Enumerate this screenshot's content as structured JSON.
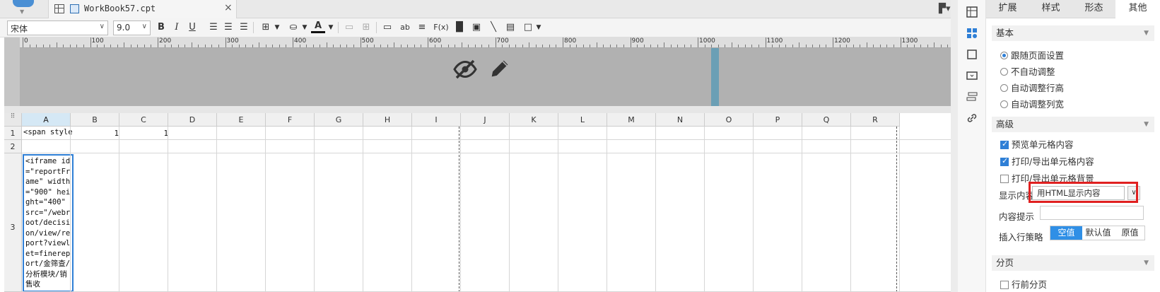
{
  "tab": {
    "title": "WorkBook57.cpt",
    "close": "×"
  },
  "toolbar": {
    "font": "宋体",
    "size": "9.0",
    "bold": "B",
    "italic": "I",
    "underline": "U",
    "text_color_glyph": "A",
    "text_tool": "ab",
    "formula": "F(x)"
  },
  "ruler": {
    "ticks": [
      "0",
      "100",
      "200",
      "300",
      "400",
      "500",
      "600",
      "700",
      "800",
      "900",
      "1000",
      "1100",
      "1200",
      "1300"
    ]
  },
  "sheet": {
    "columns": [
      "A",
      "B",
      "C",
      "D",
      "E",
      "F",
      "G",
      "H",
      "I",
      "J",
      "K",
      "L",
      "M",
      "N",
      "O",
      "P",
      "Q",
      "R"
    ],
    "rows": [
      "1",
      "2",
      "3"
    ],
    "cells": {
      "a1": "<span style",
      "b1": "1",
      "c1": "1",
      "a3": "<iframe id=\"reportFrame\" width=\"900\" height=\"400\" src=\"/webroot/decision/view/report?viewlet=finereport/金筛查/分析模块/销售收"
    }
  },
  "panel": {
    "tabs": [
      "扩展",
      "样式",
      "形态",
      "其他"
    ],
    "active_tab": "其他",
    "basic_section": "基本",
    "radios": [
      "跟随页面设置",
      "不自动调整",
      "自动调整行高",
      "自动调整列宽"
    ],
    "advanced_section": "高级",
    "checkboxes": [
      "预览单元格内容",
      "打印/导出单元格内容",
      "打印/导出单元格背景"
    ],
    "display_label": "显示内容",
    "display_value": "用HTML显示内容",
    "hint_label": "内容提示",
    "insert_label": "插入行策略",
    "insert_options": [
      "空值",
      "默认值",
      "原值"
    ],
    "paging_section": "分页",
    "paging_option": "行前分页"
  },
  "colors": {
    "accent": "#2f8fe6",
    "highlight": "#e02020",
    "selection": "#2f7fd6"
  }
}
